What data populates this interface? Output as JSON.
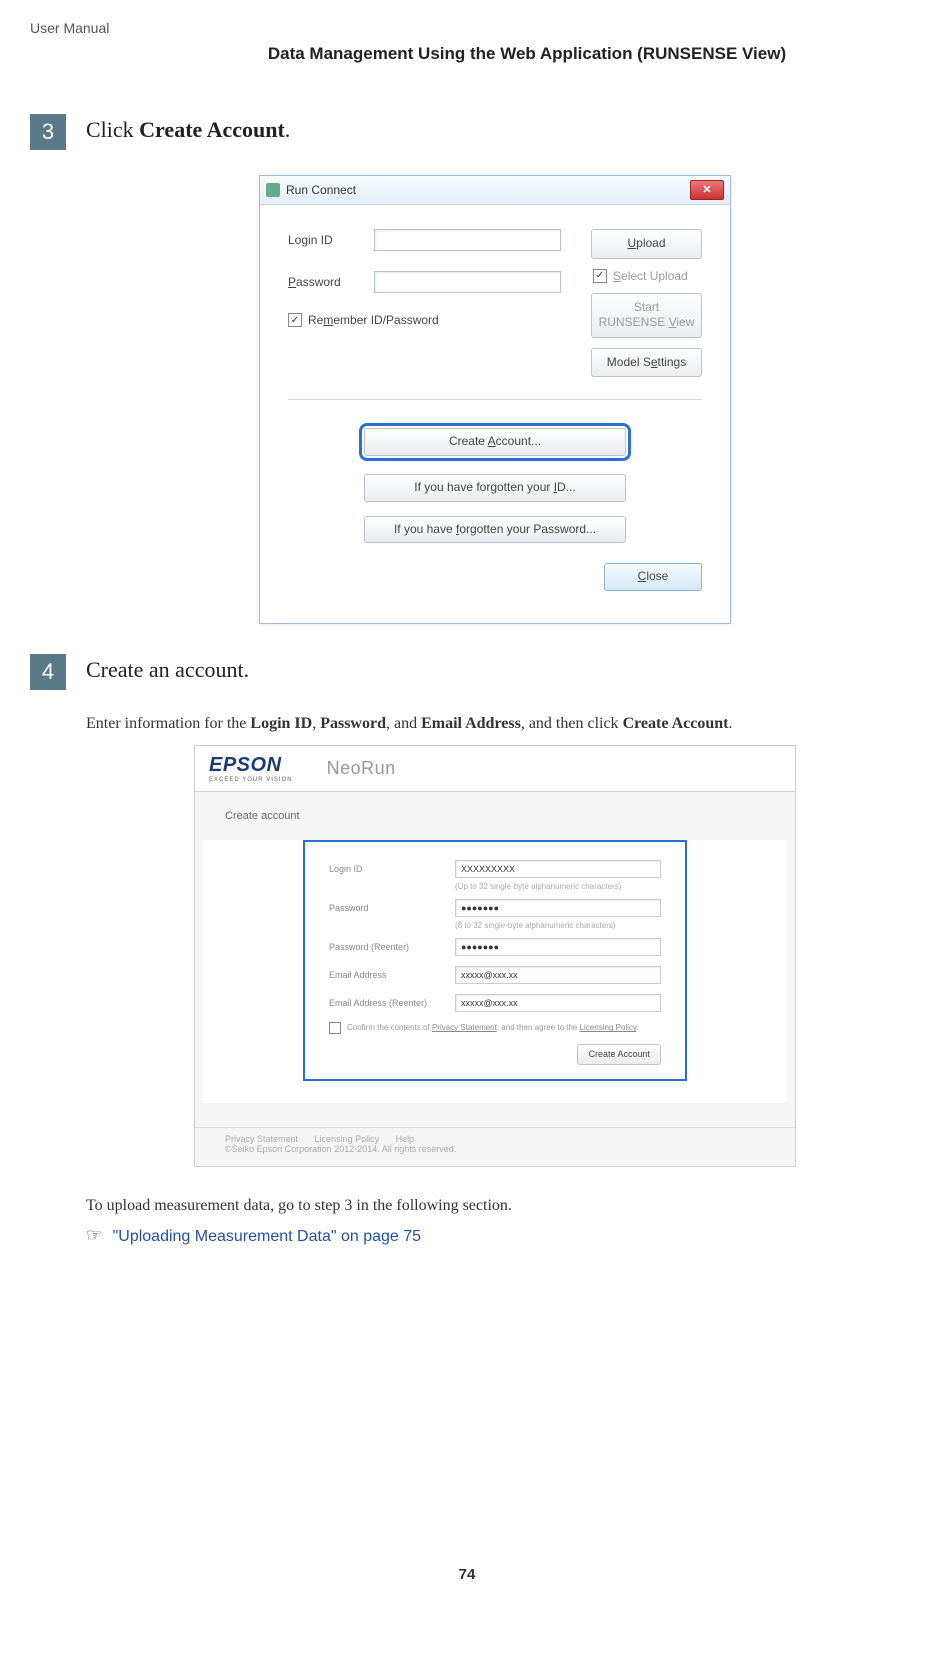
{
  "doc_header": "User Manual",
  "section_title": "Data Management Using the Web Application (RUNSENSE View)",
  "steps": {
    "s3": {
      "number": "3",
      "title_pre": "Click ",
      "title_bold": "Create Account",
      "title_post": "."
    },
    "s4": {
      "number": "4",
      "title": "Create an account."
    }
  },
  "runconnect": {
    "window_title": "Run Connect",
    "login_label": "Login ID",
    "password_label": "Password",
    "remember_label": "Remember ID/Password",
    "upload_btn": "Upload",
    "select_upload_label": "Select Upload",
    "start_btn_line1": "Start",
    "start_btn_line2": "RUNSENSE View",
    "model_settings_btn": "Model Settings",
    "create_account_btn": "Create Account...",
    "forgot_id_btn": "If you have forgotten your ID...",
    "forgot_pw_btn": "If you have forgotten your Password...",
    "close_btn": "Close"
  },
  "step4_intro": {
    "pre": "Enter information for the ",
    "b1": "Login ID",
    "mid1": ", ",
    "b2": "Password",
    "mid2": ", and ",
    "b3": "Email Address",
    "mid3": ", and then click ",
    "b4": "Create Account",
    "post": "."
  },
  "neorun": {
    "brand": "EPSON",
    "brand_sub": "EXCEED YOUR VISION",
    "product": "NeoRun",
    "section_label": "Create account",
    "login_label": "Login ID",
    "login_value": "XXXXXXXXX",
    "login_note": "(Up to 32 single-byte alphanumeric characters)",
    "password_label": "Password",
    "password_value": "●●●●●●●",
    "password_note": "(8 to 32 single-byte alphanumeric characters)",
    "password2_label": "Password (Reenter)",
    "password2_value": "●●●●●●●",
    "email_label": "Email Address",
    "email_value": "xxxxx@xxx.xx",
    "email2_label": "Email Address (Reenter)",
    "email2_value": "xxxxx@xxx.xx",
    "confirm_pre": "Confirm the contents of ",
    "confirm_link1": "Privacy Statement",
    "confirm_mid": ", and then agree to the ",
    "confirm_link2": "Licensing Policy",
    "confirm_post": ".",
    "submit_btn": "Create Account",
    "footer_link1": "Privacy Statement",
    "footer_link2": "Licensing Policy",
    "footer_link3": "Help",
    "footer_copy": "©Seiko Epson Corporation 2012-2014. All rights reserved."
  },
  "after_note": "To upload measurement data, go to step 3 in the following section.",
  "cross_ref": "\"Uploading Measurement Data\" on page 75",
  "hand_icon": "☞",
  "page_number": "74"
}
